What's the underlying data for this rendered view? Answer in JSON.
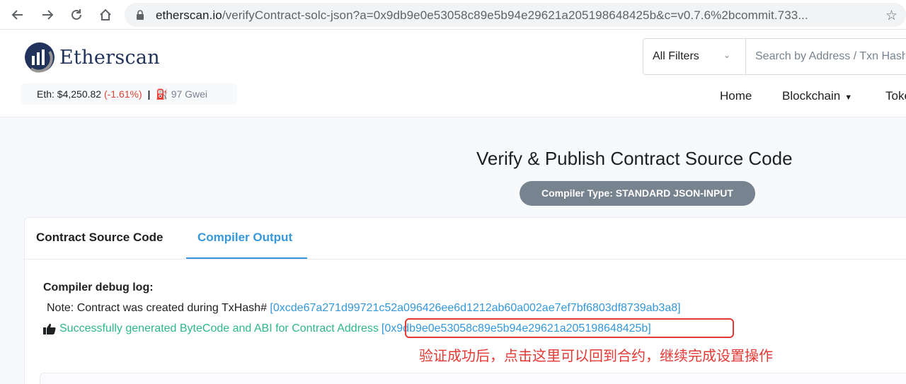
{
  "browser": {
    "url_host": "etherscan.io",
    "url_path": "/verifyContract-solc-json?a=0x9db9e0e53058c89e5b94e29621a205198648425b&c=v0.7.6%2bcommit.733..."
  },
  "header": {
    "logo_text": "Etherscan",
    "eth_label": "Eth: $4,250.82",
    "eth_change": "(-1.61%)",
    "separator": "|",
    "gas": "97 Gwei",
    "filter_label": "All Filters",
    "search_placeholder": "Search by Address / Txn Hash",
    "nav": [
      "Home",
      "Blockchain",
      "Tokens"
    ]
  },
  "main": {
    "title": "Verify & Publish Contract Source Code",
    "badge": "Compiler Type: STANDARD JSON-INPUT",
    "tabs": [
      {
        "label": "Contract Source Code",
        "active": false
      },
      {
        "label": "Compiler Output",
        "active": true
      }
    ],
    "debug_label": "Compiler debug log:",
    "note_prefix": "Note: Contract was created during TxHash#",
    "tx_hash": "[0xcde67a271d99721c52a096426ee6d1212ab60a002ae7ef7bf6803df8739ab3a8]",
    "success_text": "Successfully generated ByteCode and ABI for Contract Address",
    "contract_address": "[0x9db9e0e53058c89e5b94e29621a205198648425b]"
  },
  "annotation": {
    "text": "验证成功后，点击这里可以回到合约，继续完成设置操作",
    "color": "#e53935"
  },
  "colors": {
    "accent": "#3498db",
    "success": "#2eb886",
    "brand": "#21325b"
  }
}
